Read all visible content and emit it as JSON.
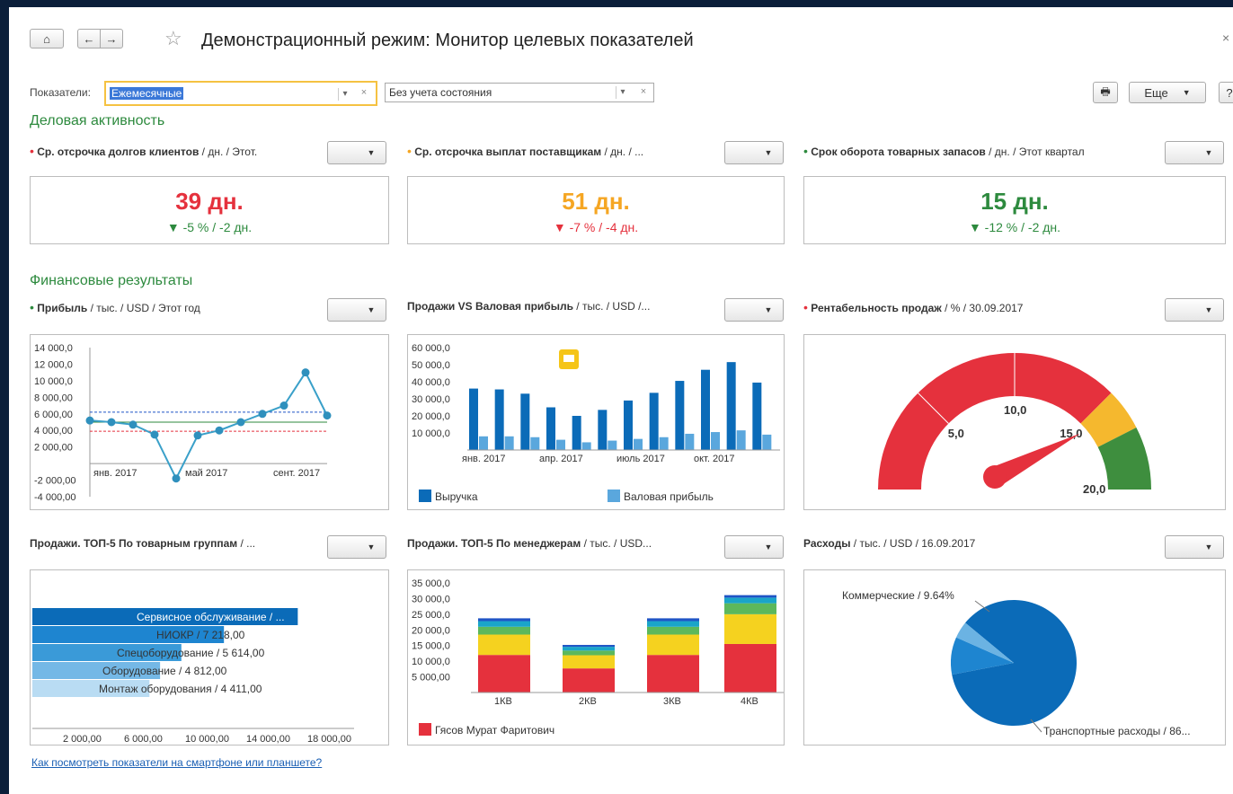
{
  "window": {
    "title": "Демонстрационный режим: Монитор целевых показателей",
    "close": "×"
  },
  "toolbar": {
    "home": "⌂",
    "back": "←",
    "forward": "→",
    "star": "☆",
    "print": "🖶",
    "more": "Еще",
    "more_arrow": "▼",
    "help": "?"
  },
  "filters": {
    "indicators_label": "Показатели:",
    "indicators_value": "Ежемесячные",
    "state_value": "Без учета состояния",
    "dropdown": "▾",
    "clear": "×"
  },
  "colors": {
    "red": "#e5313d",
    "orange": "#f5a623",
    "green": "#2d8a3e",
    "blue_dark": "#0b6bb8",
    "blue_light": "#5aa7dd"
  },
  "sections": {
    "business": "Деловая активность",
    "finance": "Финансовые результаты"
  },
  "kpis": [
    {
      "name": "Ср. отсрочка долгов клиентов",
      "meta": " / дн. / Этот.",
      "status": "red",
      "value": "39 дн.",
      "delta": "▼ -5 % / -2 дн.",
      "delta_color": "green"
    },
    {
      "name": "Ср. отсрочка выплат поставщикам",
      "meta": " / дн. / ...",
      "status": "orange",
      "value": "51 дн.",
      "delta": "▼ -7 % / -4 дн.",
      "delta_color": "red"
    },
    {
      "name": "Срок оборота товарных запасов",
      "meta": " / дн. / Этот квартал",
      "status": "green",
      "value": "15 дн.",
      "delta": "▼ -12 % / -2 дн.",
      "delta_color": "green"
    }
  ],
  "widgets": {
    "profit": {
      "name": "Прибыль",
      "meta": " / тыс. / USD / Этот год",
      "status": "green"
    },
    "sales_vs": {
      "name": "Продажи VS Валовая прибыль",
      "meta": " / тыс. / USD /..."
    },
    "rentab": {
      "name": "Рентабельность продаж",
      "meta": " / % / 30.09.2017",
      "status": "red"
    },
    "top_groups": {
      "name": "Продажи. ТОП-5 По товарным группам",
      "meta": " / ..."
    },
    "top_managers": {
      "name": "Продажи. ТОП-5 По менеджерам",
      "meta": " / тыс. / USD..."
    },
    "expenses": {
      "name": "Расходы",
      "meta": " / тыс. / USD / 16.09.2017"
    }
  },
  "chart_data": [
    {
      "type": "line",
      "y_ticks": [
        "14 000,0",
        "12 000,0",
        "10 000,0",
        "8 000,00",
        "6 000,00",
        "4 000,00",
        "2 000,00",
        "-2 000,00",
        "-4 000,00"
      ],
      "x_ticks": [
        "янв. 2017",
        "май 2017",
        "сент. 2017"
      ],
      "ylim": [
        -4000,
        14000
      ],
      "x": [
        "дек. 2016",
        "янв. 2017",
        "февр. 2017",
        "март 2017",
        "апр. 2017",
        "май 2017",
        "июнь 2017",
        "июль 2017",
        "авг. 2017",
        "сент. 2017",
        "окт. 2017",
        "нояб. 2017"
      ],
      "values": [
        5200,
        5000,
        4700,
        3500,
        -1800,
        3400,
        4000,
        5000,
        6000,
        7000,
        11000,
        5800
      ],
      "reference_lines": [
        {
          "value": 6200,
          "color": "blue"
        },
        {
          "value": 5000,
          "color": "green"
        },
        {
          "value": 3900,
          "color": "red"
        }
      ]
    },
    {
      "type": "bar",
      "y_ticks": [
        "60 000,0",
        "50 000,0",
        "40 000,0",
        "30 000,0",
        "20 000,0",
        "10 000,0"
      ],
      "x_ticks": [
        "янв. 2017",
        "апр. 2017",
        "июль 2017",
        "окт. 2017"
      ],
      "ylim": [
        0,
        60000
      ],
      "series": [
        {
          "name": "Выручка",
          "values": [
            36000,
            35500,
            33000,
            25000,
            20000,
            23500,
            29000,
            33500,
            40500,
            47000,
            51500,
            39500
          ]
        },
        {
          "name": "Валовая прибыль",
          "values": [
            8000,
            8000,
            7500,
            6000,
            4500,
            5500,
            6500,
            7500,
            9500,
            10500,
            11500,
            9000
          ]
        }
      ],
      "legend": [
        "Выручка",
        "Валовая прибыль"
      ]
    },
    {
      "type": "gauge",
      "value": 15.5,
      "range": [
        0,
        20
      ],
      "ticks": [
        "5,0",
        "10,0",
        "15,0",
        "20,0"
      ],
      "zones": [
        {
          "from": 0,
          "to": 15,
          "color": "red"
        },
        {
          "from": 15,
          "to": 17,
          "color": "orange"
        },
        {
          "from": 17,
          "to": 20,
          "color": "green"
        }
      ]
    },
    {
      "type": "bar",
      "orientation": "horizontal",
      "categories": [
        "Сервисное обслуживание / ...",
        "НИОКР / 7 218,00",
        "Спецоборудование / 5 614,00",
        "Оборудование / 4 812,00",
        "Монтаж оборудования / 4 411,00"
      ],
      "values": [
        16500,
        7218,
        5614,
        4812,
        4411
      ],
      "x_ticks": [
        "2 000,00",
        "6 000,00",
        "10 000,00",
        "14 000,00",
        "18 000,00"
      ],
      "xlim": [
        0,
        20000
      ]
    },
    {
      "type": "bar",
      "stacked": true,
      "categories": [
        "1КВ",
        "2КВ",
        "3КВ",
        "4КВ"
      ],
      "y_ticks": [
        "35 000,0",
        "30 000,0",
        "25 000,0",
        "20 000,0",
        "15 000,0",
        "10 000,0",
        "5 000,00"
      ],
      "ylim": [
        0,
        35000
      ],
      "series": [
        {
          "name": "Гясов Мурат Фаритович",
          "values": [
            12000,
            7700,
            12000,
            15500
          ]
        },
        {
          "values": [
            6500,
            4200,
            6500,
            9500
          ]
        },
        {
          "values": [
            2500,
            1500,
            2500,
            3500
          ]
        },
        {
          "values": [
            1800,
            1200,
            1800,
            1800
          ]
        },
        {
          "values": [
            900,
            600,
            900,
            800
          ]
        }
      ],
      "legend": [
        "Гясов Мурат Фаритович"
      ]
    },
    {
      "type": "pie",
      "slices": [
        {
          "label": "Транспортные расходы / 86...",
          "value": 86
        },
        {
          "label": "Коммерческие / 9.64%",
          "value": 9.64
        },
        {
          "value": 4.36
        }
      ]
    }
  ],
  "labels": {
    "line_ylabels": [
      "14 000,0",
      "12 000,0",
      "10 000,0",
      "8 000,00",
      "6 000,00",
      "4 000,00",
      "2 000,00",
      "-2 000,00",
      "-4 000,00"
    ],
    "footer_link": "Как посмотреть показатели на смартфоне или планшете?"
  }
}
